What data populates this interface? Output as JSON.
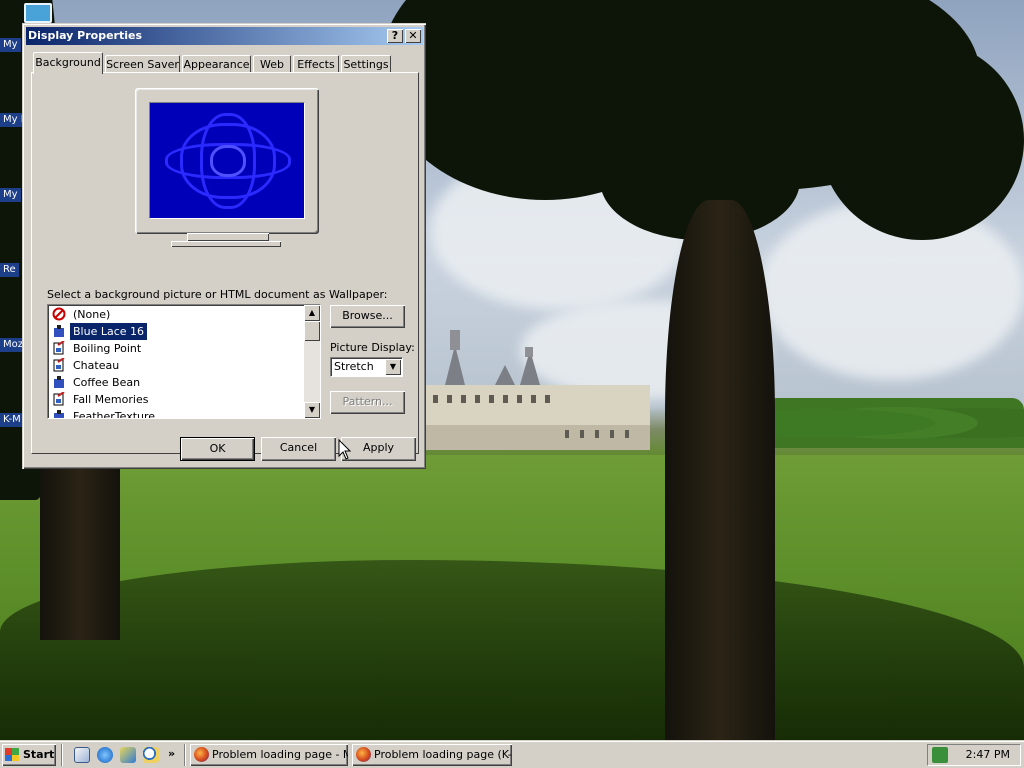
{
  "desktop": {
    "icons": [
      {
        "label": "My"
      },
      {
        "label": "My D"
      },
      {
        "label": "My"
      },
      {
        "label": "Re"
      },
      {
        "label": "Moz"
      },
      {
        "label": "K-M"
      }
    ]
  },
  "dialog": {
    "title": "Display Properties",
    "help_button": "?",
    "close_button": "✕",
    "tabs": [
      {
        "label": "Background",
        "active": true
      },
      {
        "label": "Screen Saver"
      },
      {
        "label": "Appearance"
      },
      {
        "label": "Web"
      },
      {
        "label": "Effects"
      },
      {
        "label": "Settings"
      }
    ],
    "wallpaper_prompt": "Select a background picture or HTML document as Wallpaper:",
    "wallpapers": [
      {
        "label": "(None)",
        "icon": "none-icon"
      },
      {
        "label": "Blue Lace 16",
        "icon": "paint-icon",
        "selected": true
      },
      {
        "label": "Boiling Point",
        "icon": "document-icon"
      },
      {
        "label": "Chateau",
        "icon": "document-icon"
      },
      {
        "label": "Coffee Bean",
        "icon": "paint-icon"
      },
      {
        "label": "Fall Memories",
        "icon": "document-icon"
      },
      {
        "label": "FeatherTexture",
        "icon": "paint-icon"
      }
    ],
    "browse_button": "Browse...",
    "picture_display_label": "Picture Display:",
    "picture_display_value": "Stretch",
    "pattern_button": "Pattern...",
    "ok_button": "OK",
    "cancel_button": "Cancel",
    "apply_button": "Apply",
    "colors": {
      "title_start": "#0a246a",
      "title_end": "#a6caf0",
      "preview": "#0000b8",
      "face": "#d4d0c8"
    }
  },
  "taskbar": {
    "start_label": "Start",
    "quick_launch": [
      {
        "icon": "show-desktop-icon"
      },
      {
        "icon": "internet-explorer-icon"
      },
      {
        "icon": "outlook-express-icon"
      },
      {
        "icon": "search-icon"
      }
    ],
    "overflow": "»",
    "tasks": [
      {
        "label": "Problem loading page - M...",
        "icon": "firefox-icon"
      },
      {
        "label": "Problem loading page (K-...",
        "icon": "firefox-icon"
      }
    ],
    "clock": "2:47 PM"
  }
}
